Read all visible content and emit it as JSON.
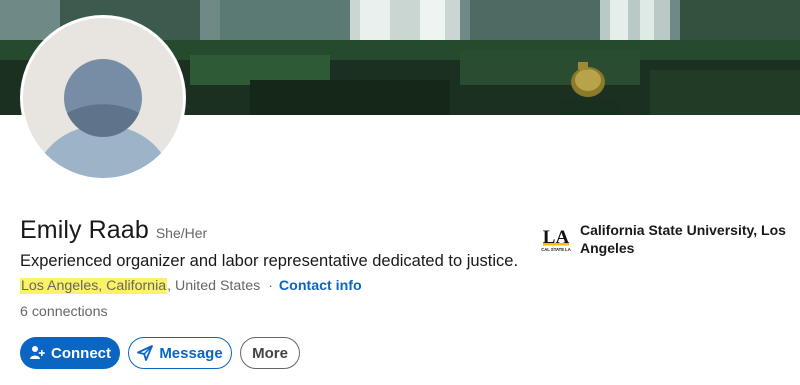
{
  "profile": {
    "name": "Emily Raab",
    "pronouns": "She/Her",
    "headline": "Experienced organizer and labor representative dedicated to justice.",
    "location_highlighted": "Los Angeles, California",
    "location_rest": ", United States",
    "separator": "·",
    "contact_info": "Contact info",
    "connections_count": "6",
    "connections_label": " connections"
  },
  "education": {
    "school": "California State University, Los Angeles",
    "logo_text": "LA",
    "logo_subtext": "CAL STATE LA"
  },
  "actions": {
    "connect": "Connect",
    "message": "Message",
    "more": "More"
  },
  "colors": {
    "accent": "#0a66c2",
    "highlight": "#fbf266",
    "text_secondary": "#666666"
  }
}
